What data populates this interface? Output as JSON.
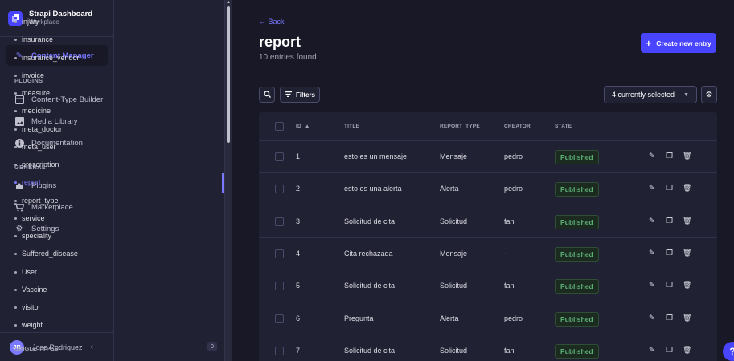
{
  "brand": {
    "title": "Strapi Dashboard",
    "subtitle": "Workplace",
    "logo_char": "ᐧ"
  },
  "mainnav": {
    "content_manager": "Content Manager",
    "plugins_section": "PLUGINS",
    "plugins": [
      "Content-Type Builder",
      "Media Library",
      "Documentation"
    ],
    "general_section": "GENERAL",
    "general": [
      "Plugins",
      "Marketplace",
      "Settings"
    ],
    "user": {
      "initials": "JR",
      "name": "Jose Rodriguez"
    },
    "collapse_icon": "chevron-left-icon"
  },
  "subnav": {
    "items": [
      "injury",
      "insurance",
      "insurance_vendor",
      "invoice",
      "measure",
      "medicine",
      "meta_doctor",
      "meta_user",
      "prescription",
      "report",
      "report_type",
      "service",
      "speciality",
      "Suffered_disease",
      "User",
      "Vaccine",
      "visitor",
      "weight"
    ],
    "active": "report",
    "single_types_label": "SINGLE TYPES",
    "single_types_count": "0"
  },
  "main": {
    "back_label": "← Back",
    "title": "report",
    "entries_found": "10 entries found",
    "create_label": "Create new entry",
    "filters_label": "Filters",
    "columns_select": "4 currently selected"
  },
  "table": {
    "headers": {
      "id": "ID",
      "title": "TITLE",
      "report_type": "REPORT_TYPE",
      "creator": "CREATOR",
      "state": "STATE"
    },
    "sort_indicator": "▲",
    "rows": [
      {
        "id": "1",
        "title": "esto es un mensaje",
        "report_type": "Mensaje",
        "creator": "pedro",
        "state": "Published"
      },
      {
        "id": "2",
        "title": "esto es una alerta",
        "report_type": "Alerta",
        "creator": "pedro",
        "state": "Published"
      },
      {
        "id": "3",
        "title": "Solicitud de cita",
        "report_type": "Solicitud",
        "creator": "fan",
        "state": "Published"
      },
      {
        "id": "4",
        "title": "Cita rechazada",
        "report_type": "Mensaje",
        "creator": "-",
        "state": "Published"
      },
      {
        "id": "5",
        "title": "Solicitud de cita",
        "report_type": "Solicitud",
        "creator": "fan",
        "state": "Published"
      },
      {
        "id": "6",
        "title": "Pregunta",
        "report_type": "Alerta",
        "creator": "pedro",
        "state": "Published"
      },
      {
        "id": "7",
        "title": "Solicitud de cita",
        "report_type": "Solicitud",
        "creator": "fan",
        "state": "Published"
      }
    ]
  },
  "colors": {
    "primary": "#4945ff",
    "accent": "#7b79ff",
    "bg": "#181826",
    "panel": "#212134",
    "success": "#5cb176"
  },
  "help_label": "?"
}
